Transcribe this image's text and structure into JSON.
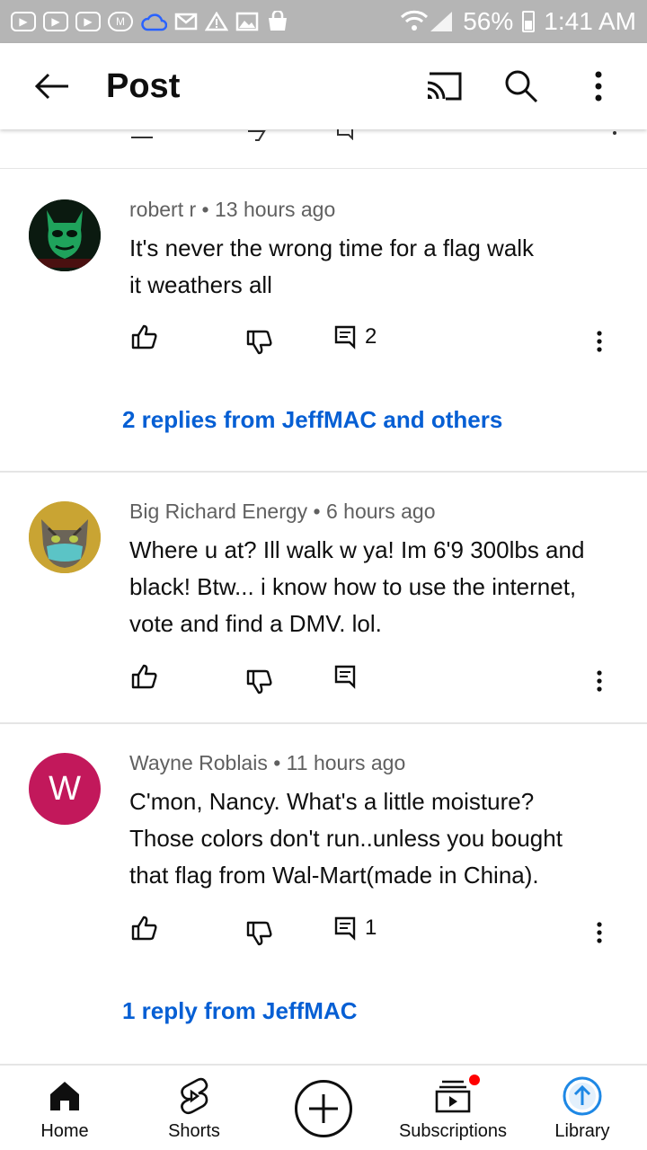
{
  "status_bar": {
    "battery": "56%",
    "time": "1:41 AM",
    "notification_icons": [
      "youtube-icon",
      "youtube-icon",
      "youtube-icon",
      "gmail-icon",
      "cloud-icon",
      "mail-icon",
      "warning-icon",
      "image-icon",
      "shopping-bag-icon"
    ]
  },
  "appbar": {
    "title": "Post",
    "icons": {
      "back": "arrow-left-icon",
      "cast": "cast-icon",
      "search": "search-icon",
      "more": "more-vert-icon"
    }
  },
  "comments": [
    {
      "author": "robert r",
      "time": "13 hours ago",
      "text_lines": [
        "It's never the wrong time for a flag walk",
        "it weathers all"
      ],
      "reply_count": "2",
      "replies_link": "2 replies from JeffMAC and others",
      "avatar": {
        "type": "image",
        "desc": "green-mask-avatar"
      }
    },
    {
      "author": "Big Richard Energy",
      "time": "6 hours ago",
      "text_lines": [
        "Where u at? Ill walk w ya! Im 6'9 300lbs and",
        "black! Btw... i know how to use the internet,",
        "vote and find a DMV. lol."
      ],
      "reply_count": "",
      "replies_link": "",
      "avatar": {
        "type": "image",
        "desc": "cat-with-mask-avatar"
      }
    },
    {
      "author": "Wayne Roblais",
      "time": "11 hours ago",
      "text_lines": [
        "C'mon, Nancy. What's a little moisture?",
        "Those colors don't run..unless you bought",
        "that flag from Wal-Mart(made in China)."
      ],
      "reply_count": "1",
      "replies_link": "1 reply from JeffMAC",
      "avatar": {
        "type": "letter",
        "letter": "W",
        "color": "#c2185b"
      }
    }
  ],
  "bottom_nav": {
    "items": [
      {
        "label": "Home",
        "icon": "home-icon"
      },
      {
        "label": "Shorts",
        "icon": "shorts-icon"
      },
      {
        "label": "",
        "icon": "create-plus-icon"
      },
      {
        "label": "Subscriptions",
        "icon": "subscriptions-icon"
      },
      {
        "label": "Library",
        "icon": "library-icon"
      }
    ]
  },
  "colors": {
    "link": "#065fd4",
    "accent_blue": "#1e88e5",
    "badge_red": "#ff0000"
  }
}
